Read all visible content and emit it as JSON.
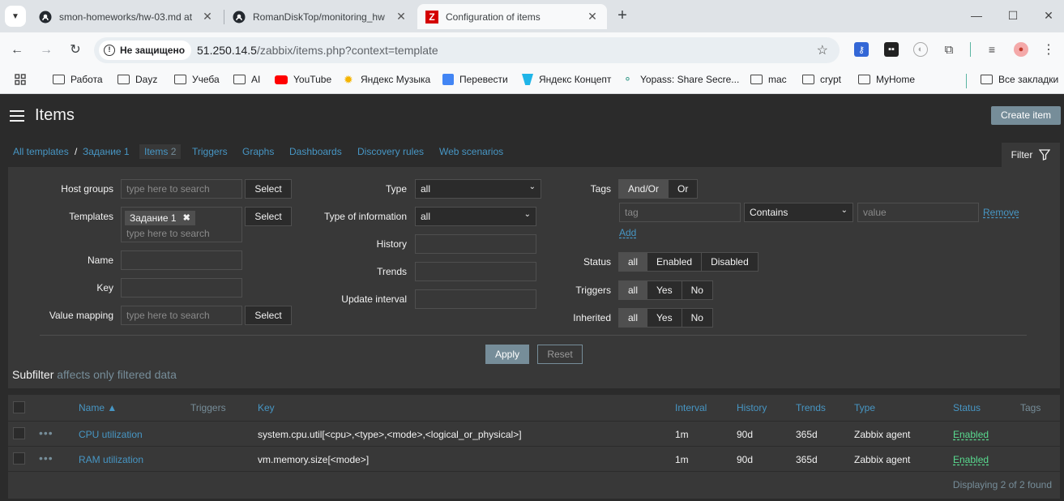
{
  "browser": {
    "tabs": [
      {
        "title": "smon-homeworks/hw-03.md at",
        "icon": "github-icon"
      },
      {
        "title": "RomanDiskTop/monitoring_hw",
        "icon": "github-icon"
      },
      {
        "title": "Configuration of items",
        "icon": "zabbix-icon",
        "active": true
      }
    ],
    "security_label": "Не защищено",
    "url_host": "51.250.14.5",
    "url_path": "/zabbix/items.php?context=template",
    "bookmarks": [
      {
        "label": "Работа",
        "icon": "folder-icon"
      },
      {
        "label": "Dayz",
        "icon": "folder-icon"
      },
      {
        "label": "Учеба",
        "icon": "folder-icon"
      },
      {
        "label": "AI",
        "icon": "folder-icon"
      },
      {
        "label": "YouTube",
        "icon": "youtube-icon"
      },
      {
        "label": "Яндекс Музыка",
        "icon": "yandex-music-icon"
      },
      {
        "label": "Перевести",
        "icon": "translate-icon"
      },
      {
        "label": "Яндекс Концепт",
        "icon": "yandex-concept-icon"
      },
      {
        "label": "Yopass: Share Secre...",
        "icon": "yopass-icon"
      },
      {
        "label": "mac",
        "icon": "folder-icon"
      },
      {
        "label": "crypt",
        "icon": "folder-icon"
      },
      {
        "label": "MyHome",
        "icon": "folder-icon"
      }
    ],
    "all_bookmarks": "Все закладки"
  },
  "header": {
    "title": "Items",
    "create_button": "Create item"
  },
  "subnav": {
    "all_templates": "All templates",
    "separator": "/",
    "template_name": "Задание 1",
    "items_label": "Items",
    "items_count": "2",
    "triggers": "Triggers",
    "graphs": "Graphs",
    "dashboards": "Dashboards",
    "discovery": "Discovery rules",
    "web": "Web scenarios",
    "filter": "Filter"
  },
  "filter": {
    "host_groups_label": "Host groups",
    "templates_label": "Templates",
    "name_label": "Name",
    "key_label": "Key",
    "value_mapping_label": "Value mapping",
    "search_placeholder": "type here to search",
    "select_button": "Select",
    "template_chip": "Задание 1",
    "type_label": "Type",
    "type_value": "all",
    "type_info_label": "Type of information",
    "type_info_value": "all",
    "history_label": "History",
    "trends_label": "Trends",
    "update_interval_label": "Update interval",
    "tags_label": "Tags",
    "tags_andor": "And/Or",
    "tags_or": "Or",
    "tag_placeholder": "tag",
    "tag_operator": "Contains",
    "value_placeholder": "value",
    "remove": "Remove",
    "add": "Add",
    "status_label": "Status",
    "status_all": "all",
    "status_enabled": "Enabled",
    "status_disabled": "Disabled",
    "triggers_label": "Triggers",
    "inherited_label": "Inherited",
    "opt_all": "all",
    "opt_yes": "Yes",
    "opt_no": "No",
    "apply": "Apply",
    "reset": "Reset",
    "subfilter": "Subfilter",
    "subfilter_note": "affects only filtered data"
  },
  "table": {
    "headers": {
      "name": "Name ▲",
      "triggers": "Triggers",
      "key": "Key",
      "interval": "Interval",
      "history": "History",
      "trends": "Trends",
      "type": "Type",
      "status": "Status",
      "tags": "Tags"
    },
    "rows": [
      {
        "name": "CPU utilization",
        "key": "system.cpu.util[<cpu>,<type>,<mode>,<logical_or_physical>]",
        "interval": "1m",
        "history": "90d",
        "trends": "365d",
        "type": "Zabbix agent",
        "status": "Enabled"
      },
      {
        "name": "RAM utilization",
        "key": "vm.memory.size[<mode>]",
        "interval": "1m",
        "history": "90d",
        "trends": "365d",
        "type": "Zabbix agent",
        "status": "Enabled"
      }
    ],
    "footer": "Displaying 2 of 2 found"
  }
}
